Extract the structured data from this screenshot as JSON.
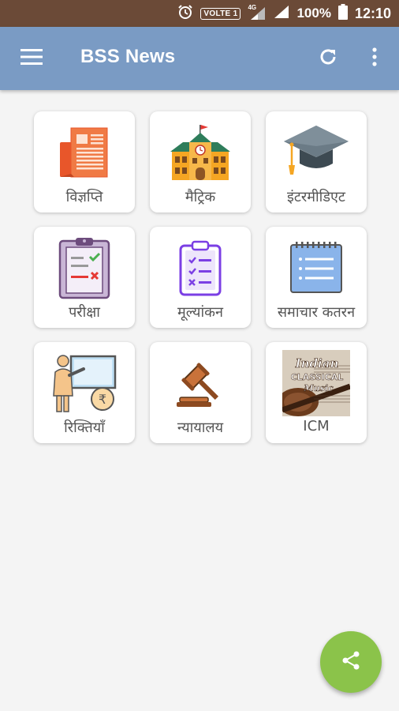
{
  "status_bar": {
    "network_badge": "VOLTE 1",
    "network_type": "4G",
    "battery": "100%",
    "time": "12:10"
  },
  "app_bar": {
    "title": "BSS News",
    "menu_icon": "hamburger-menu-icon",
    "refresh_icon": "refresh-icon",
    "more_icon": "more-vert-icon",
    "background": "#7a9bc4"
  },
  "tiles": [
    {
      "label": "विज्ञप्ति",
      "icon": "newspaper-icon"
    },
    {
      "label": "मैट्रिक",
      "icon": "school-building-icon"
    },
    {
      "label": "इंटरमीडिएट",
      "icon": "graduation-cap-icon"
    },
    {
      "label": "परीक्षा",
      "icon": "exam-clipboard-icon"
    },
    {
      "label": "मूल्यांकन",
      "icon": "evaluation-checklist-icon"
    },
    {
      "label": "समाचार कतरन",
      "icon": "notepad-icon"
    },
    {
      "label": "रिक्तियाँ",
      "icon": "vacancy-teacher-icon"
    },
    {
      "label": "न्यायालय",
      "icon": "gavel-icon"
    },
    {
      "label": "ICM",
      "icon": "indian-classical-music-image",
      "image_text": [
        "Indian",
        "CLASSICAL",
        "Music"
      ]
    }
  ],
  "fab": {
    "icon": "share-icon",
    "color": "#8bc34a"
  }
}
